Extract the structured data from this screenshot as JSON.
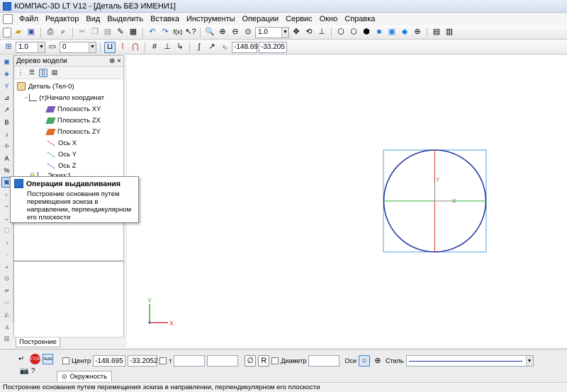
{
  "window": {
    "title": "КОМПАС-3D LT V12 - [Деталь БЕЗ ИМЕНИ1]"
  },
  "menu": [
    {
      "label": "Файл"
    },
    {
      "label": "Редактор"
    },
    {
      "label": "Вид"
    },
    {
      "label": "Выделить"
    },
    {
      "label": "Вставка"
    },
    {
      "label": "Инструменты"
    },
    {
      "label": "Операции"
    },
    {
      "label": "Сервис"
    },
    {
      "label": "Окно"
    },
    {
      "label": "Справка"
    }
  ],
  "toolbar1": {
    "zoom_value": "1.0"
  },
  "toolbar2": {
    "scale_value": "1.0",
    "layer_value": "0",
    "coord_x": "-148.69",
    "coord_y": "-33.205"
  },
  "tree": {
    "title": "Дерево модели",
    "pin": "⊕ ×",
    "items": [
      {
        "label": "Деталь (Тел-0)"
      },
      {
        "label": "(т)Начало координат"
      },
      {
        "label": "Плоскость XY"
      },
      {
        "label": "Плоскость ZX"
      },
      {
        "label": "Плоскость ZY"
      },
      {
        "label": "Ось X"
      },
      {
        "label": "Ось Y"
      },
      {
        "label": "Ось Z"
      },
      {
        "label": "Эскиз:1"
      }
    ],
    "tab_label": "Построение"
  },
  "tooltip": {
    "title": "Операция выдавливания",
    "body": "Построение основания путем перемещения эскиза в направлении, перпендикулярном его плоскости"
  },
  "viewport": {
    "axis_x": "X",
    "axis_y": "Y",
    "sketch_axis_x": "X",
    "sketch_axis_y": "Y"
  },
  "propbar": {
    "center_label": "Центр",
    "center_x": "-148.695",
    "center_y": "-33.2052",
    "tangent_label": "т",
    "radius_label": "R",
    "diameter_label": "Диаметр",
    "axes_label": "Оси",
    "style_label": "Стиль",
    "tab_label": "Окружность"
  },
  "status": {
    "text": "Построение основания путем перемещения эскиза в направлении, перпендикулярном его плоскости"
  },
  "colors": {
    "circle": "#2030a0",
    "selection_box": "#4da3e0",
    "axis_red": "#e03030",
    "axis_green": "#30b030",
    "axis_blue": "#3050c0"
  }
}
